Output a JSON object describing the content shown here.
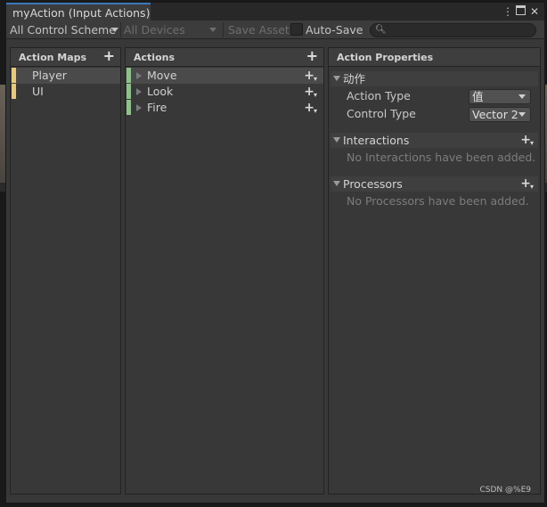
{
  "window": {
    "tab_title": "myAction (Input Actions)"
  },
  "toolbar": {
    "control_scheme": "All Control Scheme",
    "devices": "All Devices",
    "save_asset": "Save Asset",
    "auto_save": "Auto-Save",
    "auto_save_checked": false,
    "search_placeholder": ""
  },
  "action_maps": {
    "header": "Action Maps",
    "items": [
      {
        "label": "Player",
        "selected": true,
        "color": "#e8c97a"
      },
      {
        "label": "UI",
        "selected": false,
        "color": "#e8c97a"
      }
    ]
  },
  "actions": {
    "header": "Actions",
    "items": [
      {
        "label": "Move",
        "selected": true,
        "color": "#8fc28a"
      },
      {
        "label": "Look",
        "selected": false,
        "color": "#8fc28a"
      },
      {
        "label": "Fire",
        "selected": false,
        "color": "#8fc28a"
      }
    ]
  },
  "properties": {
    "header": "Action Properties",
    "action_section": "动作",
    "action_type_label": "Action Type",
    "action_type_value": "值",
    "control_type_label": "Control Type",
    "control_type_value": "Vector 2",
    "interactions_header": "Interactions",
    "interactions_empty": "No Interactions have been added.",
    "processors_header": "Processors",
    "processors_empty": "No Processors have been added."
  },
  "watermark": "CSDN @%E9",
  "icons": {
    "window_menu": "kebab-menu-icon",
    "maximize": "maximize-icon",
    "close": "close-icon",
    "search": "search-icon",
    "add": "plus-icon",
    "add_dropdown": "plus-dropdown-icon",
    "expand": "triangle-right-icon",
    "fold": "triangle-down-icon"
  },
  "colors": {
    "accent_tab": "#3a79bb",
    "map_stripe": "#e8c97a",
    "action_stripe": "#8fc28a"
  }
}
